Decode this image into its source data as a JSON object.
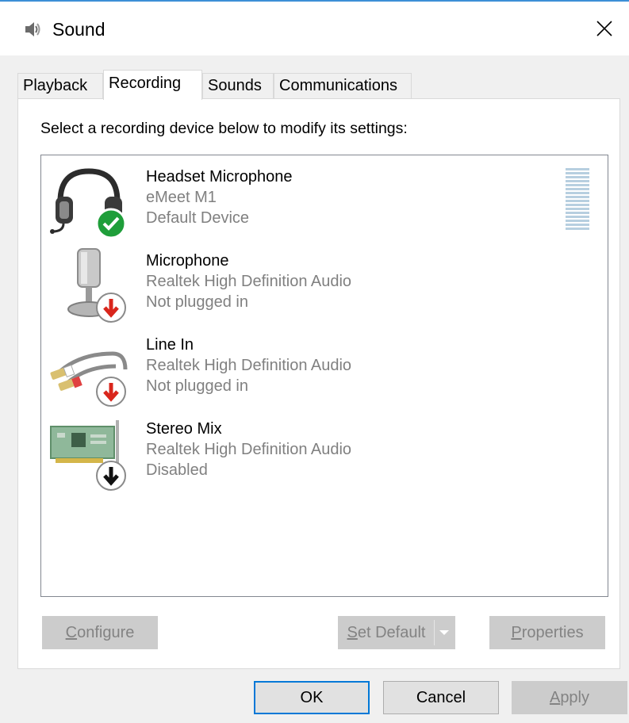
{
  "window": {
    "title": "Sound",
    "icon": "speaker-icon",
    "close_icon": "close-icon"
  },
  "tabs": [
    {
      "label": "Playback",
      "active": false
    },
    {
      "label": "Recording",
      "active": true
    },
    {
      "label": "Sounds",
      "active": false
    },
    {
      "label": "Communications",
      "active": false
    }
  ],
  "panel": {
    "instruction": "Select a recording device below to modify its settings:"
  },
  "devices": [
    {
      "name": "Headset Microphone",
      "description": "eMeet M1",
      "status": "Default Device",
      "icon": "headset-icon",
      "badge": "default-check-icon"
    },
    {
      "name": "Microphone",
      "description": "Realtek High Definition Audio",
      "status": "Not plugged in",
      "icon": "microphone-icon",
      "badge": "unplugged-arrow-icon"
    },
    {
      "name": "Line In",
      "description": "Realtek High Definition Audio",
      "status": "Not plugged in",
      "icon": "line-in-cable-icon",
      "badge": "unplugged-arrow-icon"
    },
    {
      "name": "Stereo Mix",
      "description": "Realtek High Definition Audio",
      "status": "Disabled",
      "icon": "sound-card-icon",
      "badge": "disabled-arrow-icon"
    }
  ],
  "buttons": {
    "configure": {
      "mnemonic": "C",
      "rest": "onfigure"
    },
    "set_default": {
      "mnemonic": "S",
      "rest": "et Default"
    },
    "properties": {
      "mnemonic": "P",
      "rest": "roperties"
    }
  },
  "dialog": {
    "ok": "OK",
    "cancel": "Cancel",
    "apply": {
      "mnemonic": "A",
      "rest": "pply"
    }
  },
  "colors": {
    "accent": "#0078d7",
    "default_badge": "#1f9e3a",
    "unplugged_badge": "#d9261c",
    "disabled_text": "#838383"
  }
}
